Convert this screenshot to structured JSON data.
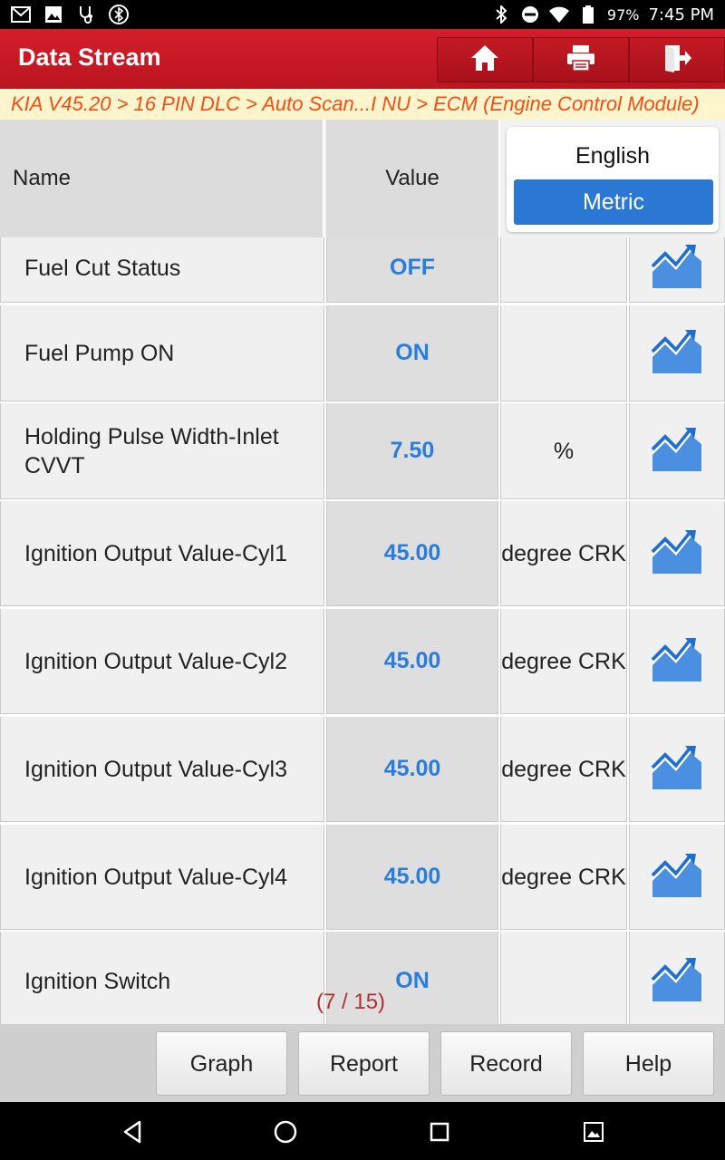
{
  "status_bar": {
    "battery": "97%",
    "time": "7:45 PM"
  },
  "header": {
    "title": "Data Stream"
  },
  "breadcrumb": "KIA V45.20 > 16 PIN DLC > Auto Scan...I NU > ECM (Engine Control Module)",
  "table": {
    "col_name": "Name",
    "col_value": "Value",
    "unit_english": "English",
    "unit_metric": "Metric",
    "rows": [
      {
        "name": "Fuel Cut Status",
        "value": "OFF",
        "unit": ""
      },
      {
        "name": "Fuel Pump ON",
        "value": "ON",
        "unit": ""
      },
      {
        "name": "Holding Pulse Width-Inlet CVVT",
        "value": "7.50",
        "unit": "%"
      },
      {
        "name": "Ignition Output Value-Cyl1",
        "value": "45.00",
        "unit": "degree CRK"
      },
      {
        "name": "Ignition Output Value-Cyl2",
        "value": "45.00",
        "unit": "degree CRK"
      },
      {
        "name": "Ignition Output Value-Cyl3",
        "value": "45.00",
        "unit": "degree CRK"
      },
      {
        "name": "Ignition Output Value-Cyl4",
        "value": "45.00",
        "unit": "degree CRK"
      },
      {
        "name": "Ignition Switch",
        "value": "ON",
        "unit": ""
      }
    ]
  },
  "page_counter": "(7 / 15)",
  "bottom_buttons": {
    "graph": "Graph",
    "report": "Report",
    "record": "Record",
    "help": "Help"
  },
  "icons": {
    "home": "home-icon",
    "print": "printer-icon",
    "exit": "exit-icon",
    "graph": "trend-graph-icon"
  },
  "colors": {
    "header_red": "#c41a25",
    "value_blue": "#2a7ddb",
    "metric_blue": "#2a77d4",
    "breadcrumb_orange": "#f24e17"
  }
}
